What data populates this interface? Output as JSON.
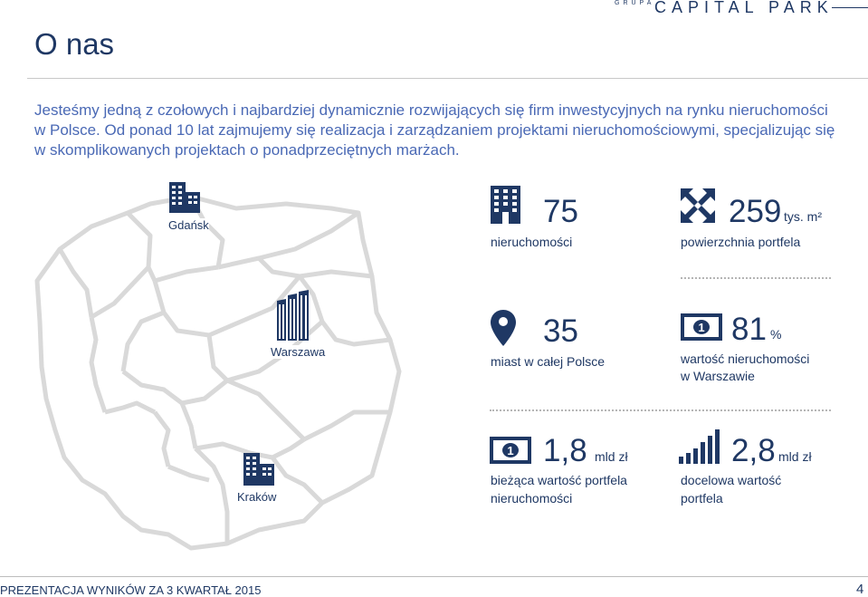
{
  "header": {
    "brand_small": "GRUPA",
    "brand_main": "CAPITAL PARK",
    "title": "O nas"
  },
  "intro": "Jesteśmy jedną z czołowych i najbardziej dynamicznie rozwijających się firm inwestycyjnych na rynku nieruchomości w Polsce. Od ponad 10 lat zajmujemy się realizacja i zarządzaniem projektami nieruchomościowymi, specjalizując się w skomplikowanych projektach o ponadprzeciętnych marżach.",
  "map": {
    "cities": [
      {
        "label": "Gdańsk",
        "icon": "building-icon"
      },
      {
        "label": "Warszawa",
        "icon": "skyscraper-icon"
      },
      {
        "label": "Kraków",
        "icon": "building-icon"
      }
    ]
  },
  "stats": [
    {
      "icon": "building-icon",
      "value": "75",
      "unit": "",
      "desc": "nieruchomości"
    },
    {
      "icon": "expand-arrows-icon",
      "value": "259",
      "unit": "tys. m²",
      "desc": "powierzchnia portfela"
    },
    {
      "icon": "map-pin-icon",
      "value": "35",
      "unit": "",
      "desc": "miast w całej  Polsce"
    },
    {
      "icon": "banknote-icon",
      "value": "81",
      "unit": "%",
      "desc_line1": "wartość nieruchomości",
      "desc_line2": "w Warszawie"
    },
    {
      "icon": "banknote-icon",
      "value": "1,8",
      "unit": "mld zł",
      "desc_line1": "bieżąca  wartość portfela",
      "desc_line2": "nieruchomości"
    },
    {
      "icon": "bar-chart-icon",
      "value": "2,8",
      "unit": "mld zł",
      "desc_line1": "docelowa wartość",
      "desc_line2": "portfela"
    }
  ],
  "footer": {
    "text": "PREZENTACJA WYNIKÓW ZA 3 KWARTAŁ 2015",
    "page": "4"
  },
  "colors": {
    "primary": "#1f3864",
    "intro_text": "#4a69b5",
    "map_outline": "#d9d9d9"
  }
}
